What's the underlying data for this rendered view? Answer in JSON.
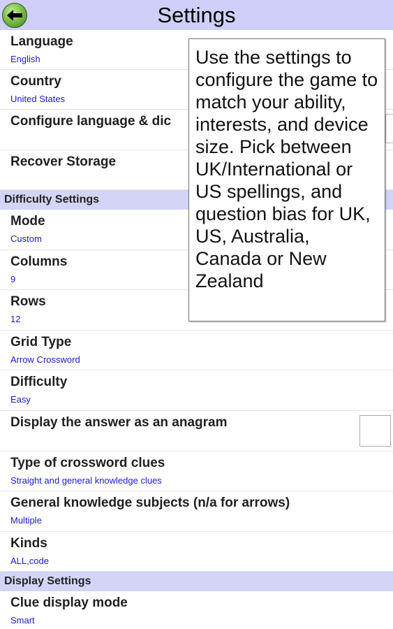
{
  "header": {
    "title": "Settings"
  },
  "rows_top": [
    {
      "label": "Language",
      "value": "English"
    },
    {
      "label": "Country",
      "value": "United States"
    },
    {
      "label": "Configure language & dic",
      "value": ""
    },
    {
      "label": "Recover Storage",
      "value": ""
    }
  ],
  "sections": {
    "difficulty": "Difficulty Settings",
    "display": "Display Settings"
  },
  "difficulty_rows": [
    {
      "label": "Mode",
      "value": "Custom"
    },
    {
      "label": "Columns",
      "value": "9"
    },
    {
      "label": "Rows",
      "value": "12"
    },
    {
      "label": "Grid Type",
      "value": "Arrow Crossword"
    },
    {
      "label": "Difficulty",
      "value": "Easy"
    },
    {
      "label": "Display the answer as an anagram",
      "value": "",
      "checked": false
    },
    {
      "label": "Type of crossword clues",
      "value": "Straight and general knowledge clues"
    },
    {
      "label": "General knowledge subjects (n/a for arrows)",
      "value": "Multiple"
    },
    {
      "label": "Kinds",
      "value": "ALL,code"
    }
  ],
  "display_rows": [
    {
      "label": "Clue display mode",
      "value": "Smart"
    }
  ],
  "tooltip": {
    "text": "Use the settings to configure the game to match your ability, interests, and device size. Pick between UK/International or US spellings, and question bias for UK, US, Australia, Canada or New Zealand"
  },
  "icons": {
    "back": "back-arrow-icon"
  },
  "colors": {
    "header_bg": "#cfcffa",
    "section_bg": "#d4d4f6",
    "value_text": "#1a1acc"
  }
}
